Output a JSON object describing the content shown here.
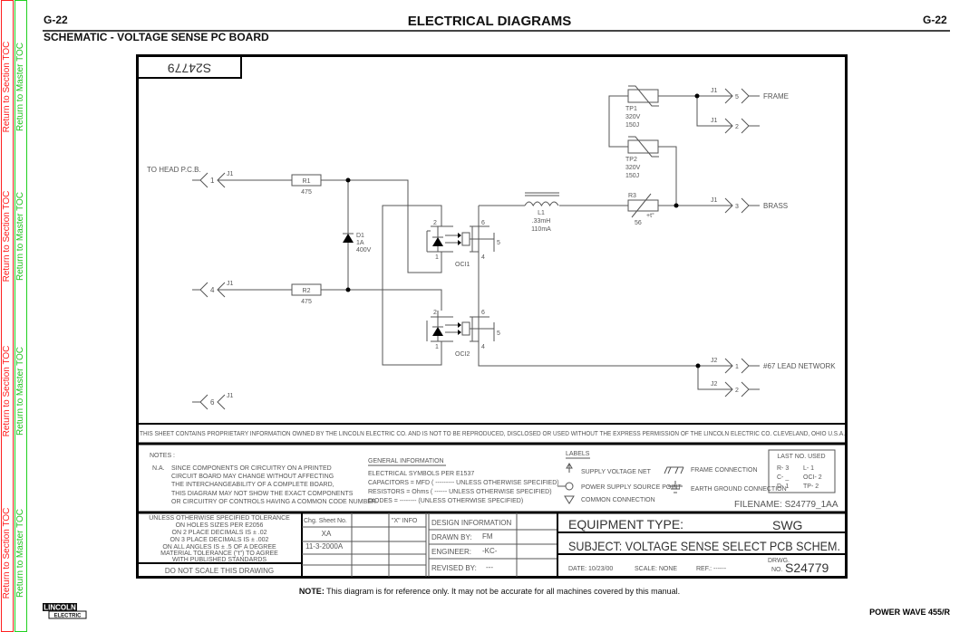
{
  "sidebar": {
    "section_toc": "Return to Section TOC",
    "master_toc": "Return to Master TOC",
    "colors": {
      "section": "#ff2020",
      "master": "#20c020"
    }
  },
  "header": {
    "page_left": "G-22",
    "title": "ELECTRICAL DIAGRAMS",
    "page_right": "G-22",
    "subtitle": "SCHEMATIC - VOLTAGE SENSE PC BOARD"
  },
  "drawing": {
    "corner_number": "S24779",
    "to_head": "TO HEAD P.C.B.",
    "left_connectors": [
      {
        "ref": "J1",
        "pin": "1"
      },
      {
        "ref": "J1",
        "pin": "4"
      },
      {
        "ref": "J1",
        "pin": "6"
      }
    ],
    "r1": {
      "ref": "R1",
      "value": "475"
    },
    "r2": {
      "ref": "R2",
      "value": "475"
    },
    "d1": {
      "ref": "D1",
      "rating1": "1A",
      "rating2": "400V"
    },
    "oci1": {
      "ref": "OCI1",
      "pins": [
        "2",
        "1",
        "6",
        "5",
        "4"
      ]
    },
    "oci2": {
      "ref": "OCI2",
      "pins": [
        "2",
        "1",
        "6",
        "5",
        "4"
      ]
    },
    "l1": {
      "ref": "L1",
      "value": ".33mH",
      "current": "110mA"
    },
    "tp1": {
      "ref": "TP1",
      "voltage": "320V",
      "energy": "150J"
    },
    "tp2": {
      "ref": "TP2",
      "voltage": "320V",
      "energy": "150J"
    },
    "r3": {
      "ref": "R3",
      "value": "56",
      "temp": "+t°"
    },
    "right_connectors": [
      {
        "ref": "J1",
        "pin": "5",
        "label": "FRAME"
      },
      {
        "ref": "J1",
        "pin": "2",
        "label": ""
      },
      {
        "ref": "J1",
        "pin": "3",
        "label": "BRASS"
      },
      {
        "ref": "J2",
        "pin": "1",
        "label": "#67 LEAD NETWORK"
      },
      {
        "ref": "J2",
        "pin": "2",
        "label": ""
      }
    ],
    "proprietary": "THIS SHEET CONTAINS PROPRIETARY INFORMATION OWNED BY THE LINCOLN ELECTRIC CO.  AND IS NOT TO BE REPRODUCED, DISCLOSED OR USED WITHOUT THE EXPRESS PERMISSION OF THE LINCOLN ELECTRIC CO.  CLEVELAND, OHIO U.S.A."
  },
  "notes": {
    "title": "NOTES :",
    "na": "N.A.",
    "lines": [
      "SINCE COMPONENTS OR CIRCUITRY ON    A PRINTED",
      "CIRCUIT BOARD    MAY CHANGE    WITHOUT AFFECTING",
      "THE INTERCHANGEABILITY    OF A COMPLETE    BOARD,",
      "THIS DIAGRAM MAY NOT    SHOW THE EXACT COMPONENTS",
      "OR CIRCUITRY OF    CONTROLS HAVING A COMMON    CODE NUMBER."
    ]
  },
  "general_info": {
    "title": "GENERAL INFORMATION",
    "lines": [
      "ELECTRICAL SYMBOLS PER E1537",
      "CAPACITORS = MFD ( --------- UNLESS OTHERWISE SPECIFIED)",
      "RESISTORS = Ohms ( ------ UNLESS OTHERWISE SPECIFIED)",
      "DIODES = -------- (UNLESS OTHERWISE SPECIFIED)"
    ]
  },
  "labels": {
    "title": "LABELS",
    "supply": "SUPPLY    VOLTAGE NET",
    "power_source": "POWER SUPPLY SOURCE POINT",
    "common": "COMMON CONNECTION",
    "frame": "FRAME CONNECTION",
    "earth": "EARTH GROUND CONNECTION"
  },
  "last_used": {
    "title": "LAST NO. USED",
    "left": [
      "R-  3",
      "C-  _",
      "D-  1"
    ],
    "right": [
      "L-  1",
      "OCI-  2",
      "TP-  2"
    ]
  },
  "filename": "FILENAME: S24779_1AA",
  "tolerance": {
    "lines": [
      "UNLESS OTHERWISE SPECIFIED TOLERANCE",
      "ON HOLES SIZES PER E2056",
      "ON 2 PLACE DECIMALS IS ± .02",
      "ON 3 PLACE DECIMALS IS ± .002",
      "ON ALL ANGLES IS ± .5 OF A DEGREE",
      "MATERIAL TOLERANCE (\"t\") TO AGREE",
      "WITH PUBLISHED STANDARDS"
    ],
    "no_scale": "DO NOT SCALE THIS DRAWING"
  },
  "change_table": {
    "header": "Chg. Sheet No.",
    "rows": [
      "XA",
      "11-3-2000A"
    ],
    "x_info": "\"X\" INFO"
  },
  "design_info": {
    "title": "DESIGN INFORMATION",
    "drawn_by_label": "DRAWN BY:",
    "drawn_by": "FM",
    "engineer_label": "ENGINEER:",
    "engineer": "-KC-",
    "revised_label": "REVISED BY:",
    "revised": "---"
  },
  "title_block": {
    "equipment_label": "EQUIPMENT TYPE:",
    "equipment": "SWG",
    "subject": "SUBJECT: VOLTAGE SENSE SELECT PCB SCHEM.",
    "date": "DATE: 10/23/00",
    "scale": "SCALE: NONE",
    "ref": "REF.: ------",
    "drwg_label_1": "DRWG.",
    "drwg_label_2": "NO.",
    "drwg_no": "S24779"
  },
  "footer": {
    "note_bold": "NOTE:",
    "note": " This diagram is for reference only. It may not be accurate for all machines covered by this manual.",
    "model": "POWER WAVE 455/R",
    "logo_top": "LINCOLN",
    "logo_bottom": "ELECTRIC"
  }
}
